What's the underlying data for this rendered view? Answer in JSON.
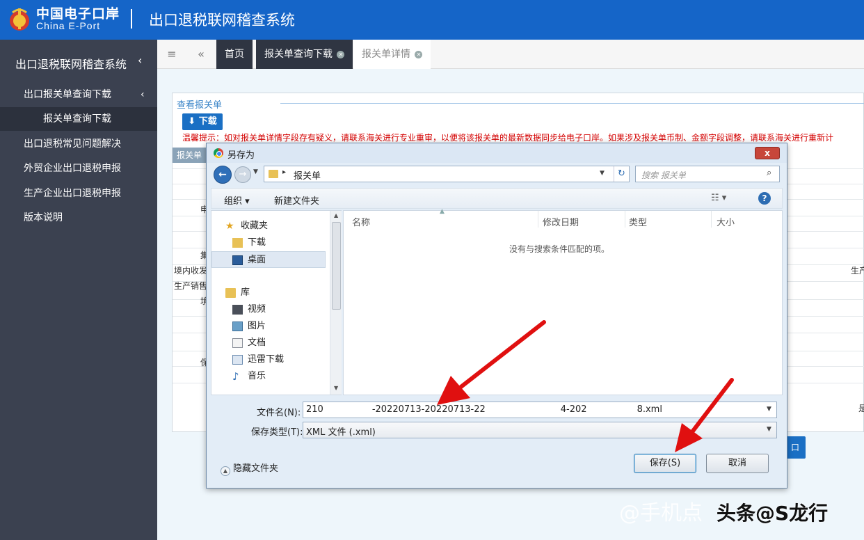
{
  "header": {
    "logo_cn": "中国电子口岸",
    "logo_en": "China E-Port",
    "system_title": "出口退税联网稽查系统"
  },
  "sidebar": {
    "title": "出口退税联网稽查系统",
    "items": [
      {
        "label": "出口报关单查询下载"
      },
      {
        "label": "报关单查询下载"
      },
      {
        "label": "出口退税常见问题解决"
      },
      {
        "label": "外贸企业出口退税申报"
      },
      {
        "label": "生产企业出口退税申报"
      },
      {
        "label": "版本说明"
      }
    ]
  },
  "tabs": [
    {
      "label": "首页"
    },
    {
      "label": "报关单查询下载"
    },
    {
      "label": "报关单详情"
    }
  ],
  "page": {
    "view_title": "查看报关单",
    "download_label": "下载",
    "warning": "温馨提示：如对报关单详情字段存有疑义，请联系海关进行专业重审，以便将该报关单的最新数据同步给电子口岸。如果涉及报关单币制、金额字段调整，请联系海关进行重新计",
    "form_head": "报关单",
    "labels": [
      "申",
      "集",
      "境内收发",
      "生产销售",
      "境",
      "保",
      "生产",
      "是"
    ],
    "hidden_button": "口"
  },
  "dialog": {
    "title": "另存为",
    "close": "x",
    "address": "报关单",
    "search_placeholder": "搜索 报关单",
    "toolbar": {
      "organize": "组织 ▾",
      "new_folder": "新建文件夹"
    },
    "nav": {
      "favorites": "收藏夹",
      "downloads": "下载",
      "desktop": "桌面",
      "libraries": "库",
      "videos": "视频",
      "pictures": "图片",
      "documents": "文档",
      "thunder": "迅雷下载",
      "music": "音乐"
    },
    "columns": [
      "名称",
      "修改日期",
      "类型",
      "大小"
    ],
    "empty_message": "没有与搜索条件匹配的项。",
    "filename_label": "文件名(N):",
    "filename_parts": [
      "210",
      "-20220713-20220713-22",
      "4-202",
      "8.xml"
    ],
    "filetype_label": "保存类型(T):",
    "filetype_value": "XML 文件 (.xml)",
    "hide_folders": "隐藏文件夹",
    "save_button": "保存(S)",
    "cancel_button": "取消"
  },
  "watermark": {
    "text": "@手机点",
    "text2": "头条@S龙行"
  },
  "colors": {
    "header_blue": "#1565c8",
    "sidebar_bg": "#3b4150",
    "warning_red": "#d40000",
    "arrow_red": "#e01010"
  }
}
